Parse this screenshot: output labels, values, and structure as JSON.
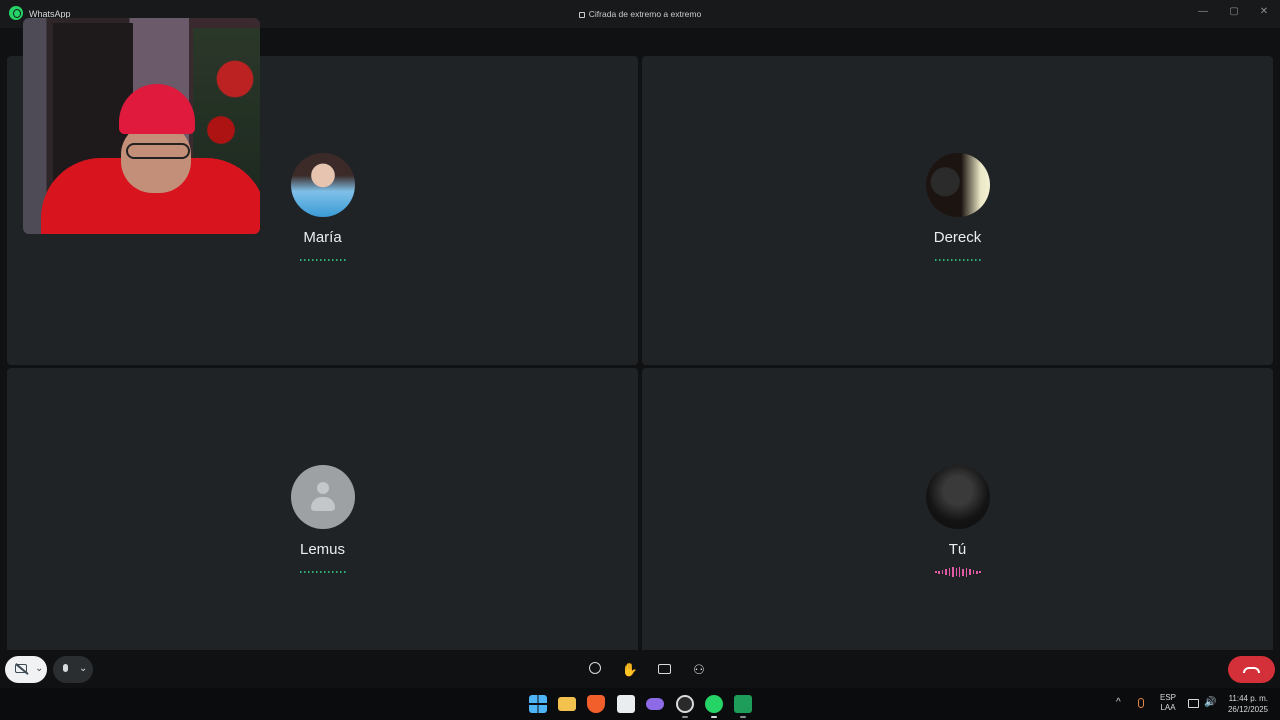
{
  "titlebar": {
    "app_name": "WhatsApp",
    "encryption_notice": "Cifrada de extremo a extremo",
    "minimize": "—",
    "maximize": "▢",
    "close": "✕"
  },
  "participants": [
    {
      "name": "María",
      "avatar": "photo",
      "speaking": false
    },
    {
      "name": "Dereck",
      "avatar": "photo",
      "speaking": false
    },
    {
      "name": "Lemus",
      "avatar": "default-person-icon",
      "speaking": false
    },
    {
      "name": "Tú",
      "avatar": "photo",
      "speaking": true
    }
  ],
  "controls": {
    "camera": "camera-off-icon",
    "mic": "mic-icon",
    "chevron": "⌄",
    "emoji": "emoji-icon",
    "raise_hand": "✋",
    "share_screen": "share-screen-icon",
    "participants": "people-icon",
    "end_call": "end-call-icon"
  },
  "colors": {
    "end_call": "#d3303a",
    "speaking_wave": "#e05aa6",
    "idle_dots": "#2bb37a",
    "tile_bg": "#202326"
  },
  "taskbar": {
    "apps": [
      "start-icon",
      "file-explorer-icon",
      "brave-icon",
      "store-icon",
      "game-icon",
      "obs-icon",
      "whatsapp-icon",
      "excel-icon"
    ],
    "tray_chevron": "^",
    "language_line1": "ESP",
    "language_line2": "LAA",
    "volume": "🔊",
    "time": "11:44 p. m.",
    "date": "26/12/2025"
  }
}
